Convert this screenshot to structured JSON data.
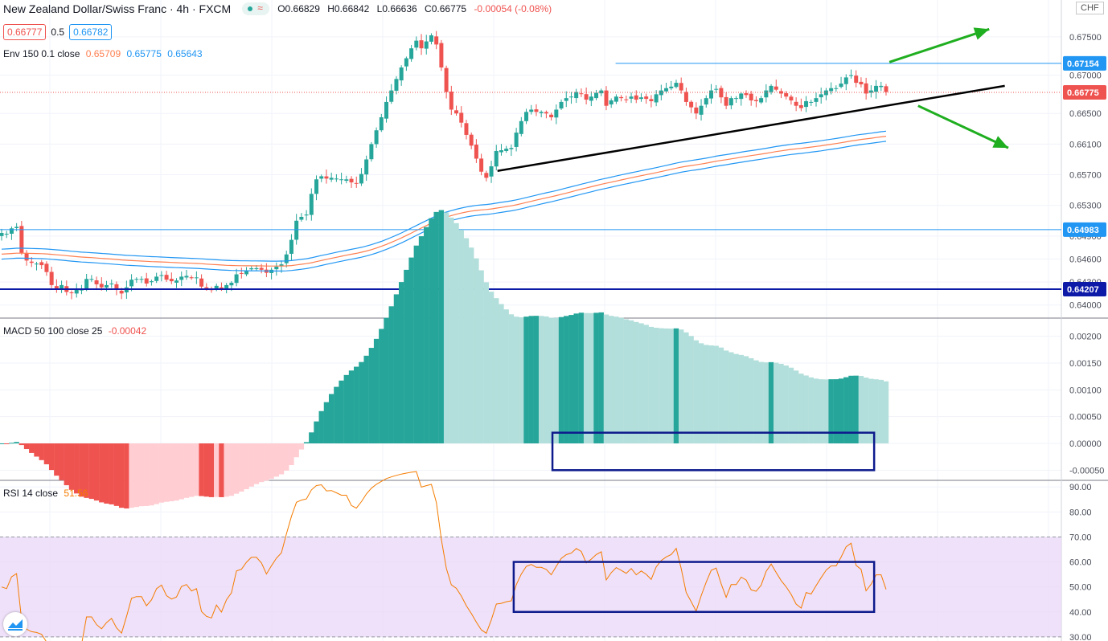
{
  "header": {
    "symbol": "New Zealand Dollar/Swiss Franc · 4h · FXCM",
    "open": "O0.66829",
    "high": "H0.66842",
    "low": "L0.66636",
    "close": "C0.66775",
    "change": "-0.00054 (-0.08%)",
    "sell_price": "0.66777",
    "spread": "0.5",
    "buy_price": "0.66782",
    "currency": "CHF"
  },
  "indicators": {
    "env_label": "Env 150 0.1 close",
    "env_values": [
      "0.65709",
      "0.65775",
      "0.65643"
    ],
    "macd_label": "MACD 50 100 close 25",
    "macd_value": "-0.00042",
    "rsi_label": "RSI 14 close",
    "rsi_value": "51.56"
  },
  "colors": {
    "up": "#26a69a",
    "down": "#ef5350",
    "macd_up_strong": "#26a69a",
    "macd_up_weak": "#b2dfdb",
    "macd_down_strong": "#ef5350",
    "macd_down_weak": "#ffcdd2",
    "env_mid": "#ff7f50",
    "env_band": "#2196f3",
    "rsi_line": "#f57c00",
    "rsi_band": "#ead7f7",
    "trendline": "#000000",
    "arrow": "#1fae1f",
    "box": "#0d1a8c",
    "level_light": "#2196f3",
    "level_dark": "#0d1aa8"
  },
  "chart_data": [
    {
      "type": "candlestick",
      "title": "New Zealand Dollar/Swiss Franc · 4h · FXCM",
      "y_ticks": [
        "0.67500",
        "0.67000",
        "0.66500",
        "0.66100",
        "0.65700",
        "0.65300",
        "0.64900",
        "0.64600",
        "0.64300",
        "0.64000"
      ],
      "ylim": [
        0.6385,
        0.6775
      ],
      "price_labels": [
        {
          "text": "0.67154",
          "value": 0.67154,
          "style": "light"
        },
        {
          "text": "0.66775",
          "value": 0.66775,
          "style": "current"
        },
        {
          "text": "0.64983",
          "value": 0.64983,
          "style": "light"
        },
        {
          "text": "0.64207",
          "value": 0.64207,
          "style": "dark"
        }
      ],
      "levels": [
        {
          "value": 0.67154,
          "from": 0.58,
          "style": "light"
        },
        {
          "value": 0.64983,
          "from": 0,
          "style": "light"
        },
        {
          "value": 0.64207,
          "from": 0,
          "style": "dark"
        }
      ],
      "trendline": {
        "from": [
          0.4687,
          0.6575
        ],
        "to": [
          0.9467,
          0.6686
        ]
      },
      "arrows": [
        {
          "from": [
            0.838,
            0.6717
          ],
          "to": [
            0.932,
            0.676
          ]
        },
        {
          "from": [
            0.865,
            0.666
          ],
          "to": [
            0.95,
            0.6605
          ]
        }
      ],
      "closes": [
        0.6494,
        0.6493,
        0.65,
        0.6502,
        0.6468,
        0.6458,
        0.6455,
        0.6454,
        0.6452,
        0.6443,
        0.6426,
        0.6421,
        0.6426,
        0.6417,
        0.6416,
        0.642,
        0.642,
        0.6434,
        0.6434,
        0.6427,
        0.6423,
        0.6426,
        0.6428,
        0.642,
        0.6415,
        0.6423,
        0.6433,
        0.6434,
        0.6434,
        0.6428,
        0.6431,
        0.6437,
        0.6439,
        0.6433,
        0.6431,
        0.6432,
        0.6437,
        0.6438,
        0.6435,
        0.6436,
        0.6424,
        0.6421,
        0.642,
        0.6425,
        0.6421,
        0.6426,
        0.6429,
        0.644,
        0.6441,
        0.6445,
        0.6448,
        0.6448,
        0.6446,
        0.6442,
        0.6446,
        0.645,
        0.6453,
        0.6466,
        0.6485,
        0.651,
        0.6515,
        0.6518,
        0.6545,
        0.6564,
        0.6568,
        0.6565,
        0.6566,
        0.6565,
        0.6564,
        0.6564,
        0.656,
        0.6559,
        0.6571,
        0.659,
        0.661,
        0.6628,
        0.6645,
        0.6665,
        0.668,
        0.6695,
        0.671,
        0.6722,
        0.6735,
        0.6745,
        0.6735,
        0.6744,
        0.6752,
        0.674,
        0.671,
        0.6678,
        0.6655,
        0.665,
        0.6638,
        0.6622,
        0.6608,
        0.6591,
        0.6574,
        0.6566,
        0.6581,
        0.6601,
        0.6602,
        0.6604,
        0.6605,
        0.6625,
        0.664,
        0.6652,
        0.6655,
        0.6652,
        0.6652,
        0.665,
        0.6645,
        0.6655,
        0.6665,
        0.667,
        0.6672,
        0.6678,
        0.6676,
        0.6668,
        0.6672,
        0.6677,
        0.668,
        0.666,
        0.6667,
        0.6672,
        0.667,
        0.6668,
        0.6672,
        0.6668,
        0.6671,
        0.6669,
        0.6666,
        0.6675,
        0.668,
        0.6683,
        0.6685,
        0.669,
        0.668,
        0.6665,
        0.6658,
        0.665,
        0.666,
        0.667,
        0.668,
        0.6682,
        0.6671,
        0.666,
        0.667,
        0.667,
        0.6676,
        0.6674,
        0.6667,
        0.6666,
        0.667,
        0.668,
        0.6686,
        0.6681,
        0.6676,
        0.6672,
        0.6667,
        0.666,
        0.6657,
        0.6666,
        0.6665,
        0.667,
        0.6675,
        0.668,
        0.6683,
        0.6683,
        0.6689,
        0.6697,
        0.67,
        0.669,
        0.6688,
        0.6676,
        0.668,
        0.6686,
        0.6686,
        0.6678
      ]
    },
    {
      "type": "histogram",
      "title": "MACD 50 100 close 25",
      "y_ticks": [
        "0.00200",
        "0.00150",
        "0.00100",
        "0.00050",
        "0.00000",
        "-0.00050"
      ],
      "ylim": [
        -0.00066,
        0.00228
      ],
      "highlight_box": {
        "x": [
          0.5205,
          0.8236
        ],
        "y": [
          -0.0005,
          0.0002
        ]
      }
    },
    {
      "type": "line",
      "title": "RSI 14 close",
      "y_ticks": [
        "90.00",
        "80.00",
        "70.00",
        "60.00",
        "50.00",
        "40.00",
        "30.00"
      ],
      "ylim": [
        29,
        92
      ],
      "band": [
        30,
        70
      ],
      "highlight_box": {
        "x": [
          0.484,
          0.8236
        ],
        "y": [
          40,
          60
        ]
      }
    }
  ]
}
